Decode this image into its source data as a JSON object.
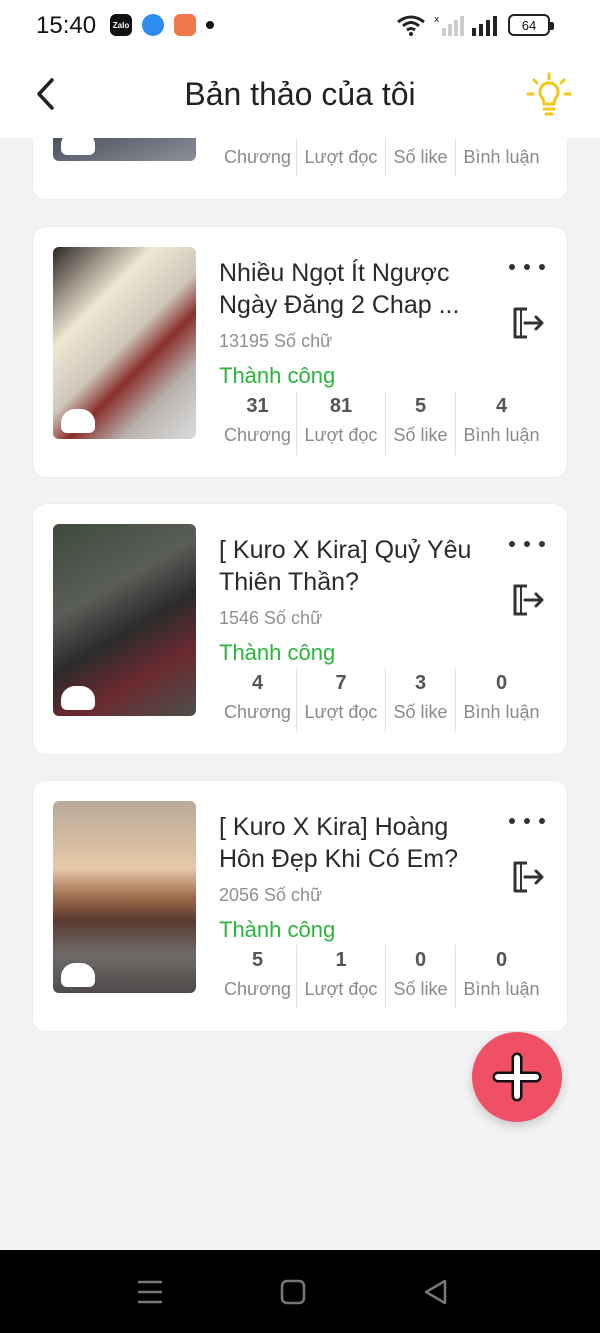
{
  "status_bar": {
    "time": "15:40",
    "battery": "64",
    "notif_icons": [
      "zalo-icon",
      "messenger-icon",
      "game-icon",
      "dot-icon"
    ],
    "right_icons": [
      "wifi-icon",
      "signal-off-icon",
      "signal-icon",
      "battery-icon"
    ]
  },
  "header": {
    "title": "Bản thảo của tôi",
    "back_icon": "chevron-left-icon",
    "tip_icon": "lightbulb-icon",
    "tip_color": "#f5c518"
  },
  "stat_labels": [
    "Chương",
    "Lượt đọc",
    "Số like",
    "Bình luận"
  ],
  "cards": [
    {
      "title": "",
      "word_count": "",
      "status": "",
      "stats": [
        "",
        "",
        "",
        ""
      ]
    },
    {
      "title": "Nhiều Ngọt Ít Ngược Ngày Đăng 2 Chap ...",
      "word_count": "13195 Số chữ",
      "status": "Thành công",
      "stats": [
        "31",
        "81",
        "5",
        "4"
      ]
    },
    {
      "title": "[ Kuro X Kira] Quỷ Yêu Thiên Thần?",
      "word_count": "1546 Số chữ",
      "status": "Thành công",
      "stats": [
        "4",
        "7",
        "3",
        "0"
      ]
    },
    {
      "title": "[ Kuro X Kira] Hoàng Hôn Đẹp Khi Có Em?",
      "word_count": "2056 Số chữ",
      "status": "Thành công",
      "stats": [
        "5",
        "1",
        "0",
        "0"
      ]
    }
  ],
  "fab": {
    "icon": "plus-icon",
    "color": "#f05065"
  },
  "colors": {
    "success": "#2bb53b",
    "background": "#f3f3f4"
  },
  "nav_bar": {
    "icons": [
      "menu-icon",
      "home-square-icon",
      "back-triangle-icon"
    ]
  }
}
